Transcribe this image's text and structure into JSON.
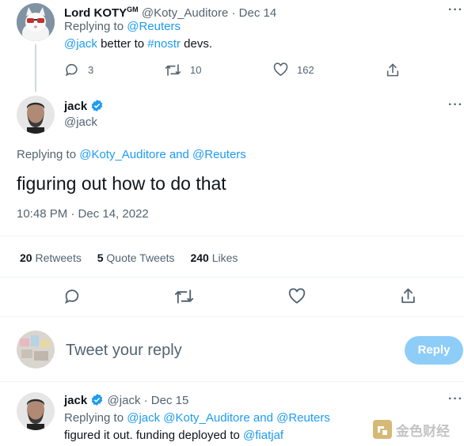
{
  "reply1": {
    "name": "Lord KOTY",
    "name_sup": "GM",
    "handle": "@Koty_Auditore",
    "sep": "·",
    "date": "Dec 14",
    "replying_prefix": "Replying to",
    "replying_to": "@Reuters",
    "text_mention": "@jack",
    "text_mid": " better to ",
    "text_hashtag": "#nostr",
    "text_end": " devs.",
    "replies": "3",
    "retweets": "10",
    "likes": "162"
  },
  "main": {
    "name": "jack",
    "handle": "@jack",
    "replying_prefix": "Replying to",
    "replying_users": "@Koty_Auditore and @Reuters",
    "text": "figuring out how to do that",
    "timestamp": "10:48 PM · Dec 14, 2022",
    "retweets_count": "20",
    "retweets_label": "Retweets",
    "quotes_count": "5",
    "quotes_label": "Quote Tweets",
    "likes_count": "240",
    "likes_label": "Likes"
  },
  "composer": {
    "placeholder": "Tweet your reply",
    "button": "Reply"
  },
  "reply2": {
    "name": "jack",
    "handle": "@jack",
    "sep": "·",
    "date": "Dec 15",
    "replying_prefix": "Replying to",
    "replying_users": "@jack @Koty_Auditore and @Reuters",
    "text": "figured it out. funding deployed to ",
    "text_mention": "@fiatjaf"
  },
  "watermark": "金色财经",
  "colors": {
    "accent": "#1d9bf0",
    "text": "#0f1419",
    "secondary": "#536471",
    "reply_button_disabled": "#8ecdf8"
  }
}
